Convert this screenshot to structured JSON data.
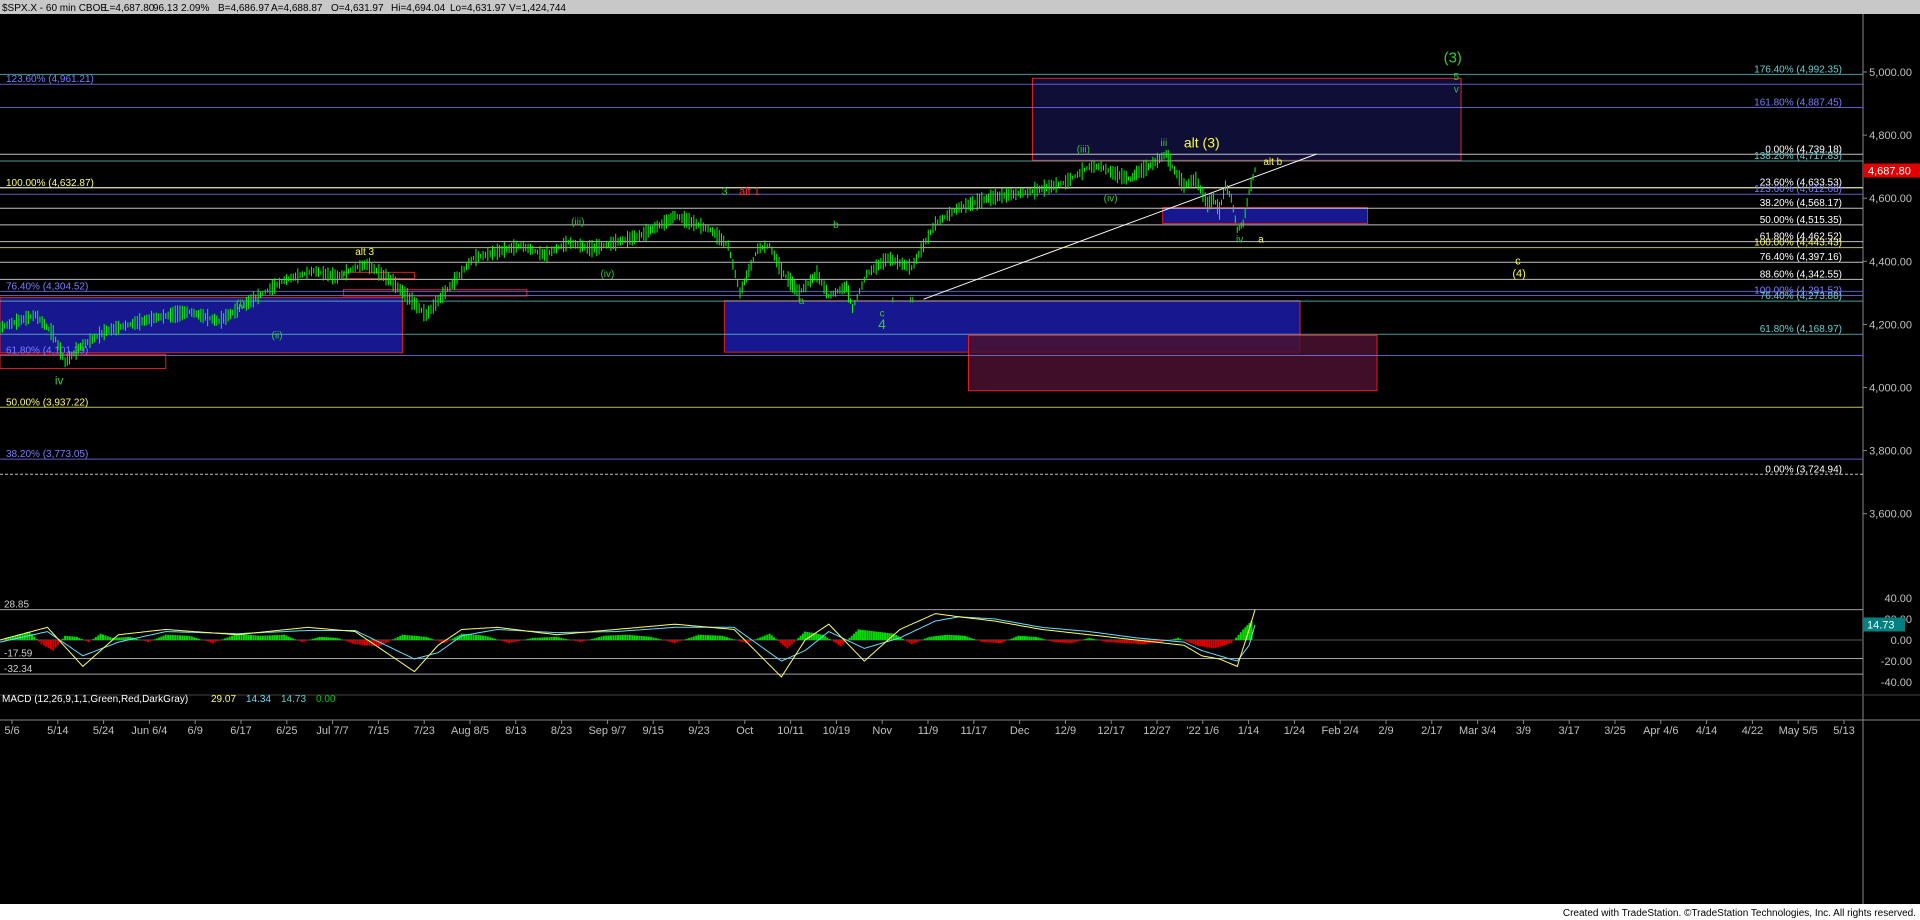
{
  "header": {
    "symbol": "$SPX.X - 60 min  CBOE",
    "last": "L=4,687.80",
    "change": "96.13",
    "pct": "2.09%",
    "bid": "B=4,686.97",
    "ask": "A=4,688.87",
    "open": "O=4,631.97",
    "high": "Hi=4,694.04",
    "low": "Lo=4,631.97",
    "volume": "V=1,424,744"
  },
  "footer": {
    "credit": "Created with TradeStation. ©TradeStation Technologies, Inc. All rights reserved."
  },
  "colors": {
    "background": "#000000",
    "price_bar": "#00ff00",
    "axis_text": "#c0c0c0",
    "fib_yellow": "#ffff66",
    "fib_blue": "#7b7bff",
    "fib_cyan": "#66cccc",
    "fib_white": "#ffffff",
    "box_blue": "#1a1a9e",
    "box_red_border": "#e02020",
    "box_purple": "#4a1030",
    "wave_green": "#33cc33",
    "wave_yellow": "#ffff33",
    "wave_red": "#ff3333",
    "macd_up": "#00dd00",
    "macd_down": "#dd0000"
  },
  "chart_data": [
    {
      "type": "line",
      "title": "$SPX.X - 60 min",
      "ylim": [
        3475,
        5075
      ],
      "y_ticks": [
        "5,000.00",
        "4,800.00",
        "4,600.00",
        "4,400.00",
        "4,200.00",
        "4,000.00",
        "3,800.00",
        "3,600.00"
      ],
      "y_tick_values": [
        5000,
        4800,
        4600,
        4400,
        4200,
        4000,
        3800,
        3600
      ],
      "last_price_label": "4,687.80",
      "last_price": 4687.8,
      "x_ticks": [
        "5/6",
        "5/14",
        "5/24",
        "Jun 6/4",
        "6/9",
        "6/17",
        "6/25",
        "Jul 7/7",
        "7/15",
        "7/23",
        "Aug 8/5",
        "8/13",
        "8/23",
        "Sep 9/7",
        "9/15",
        "9/23",
        "Oct",
        "10/11",
        "10/19",
        "Nov",
        "11/9",
        "11/17",
        "Dec",
        "12/9",
        "12/17",
        "12/27",
        "'22 1/6",
        "1/14",
        "1/24",
        "Feb 2/4",
        "2/9",
        "2/17",
        "Mar 3/4",
        "3/9",
        "3/17",
        "3/25",
        "Apr 4/6",
        "4/14",
        "4/22",
        "May 5/5",
        "5/13"
      ],
      "price_path": {
        "t": [
          0,
          30,
          45,
          55,
          68,
          90,
          130,
          160,
          185,
          210,
          240,
          265,
          285,
          300,
          310,
          330,
          360,
          400,
          440,
          460,
          480,
          500,
          540,
          555,
          565,
          570,
          580,
          600,
          615,
          625,
          640,
          650,
          660,
          675,
          690,
          700,
          715,
          720,
          732,
          750,
          770,
          790,
          810,
          835,
          850,
          870,
          900,
          920,
          930,
          940,
          955,
          960,
          970,
          985,
          990,
          1000,
          1010,
          1020,
          1025,
          1030,
          1035,
          1040,
          1045,
          1050,
          1055,
          1060
        ],
        "v": [
          4190,
          4230,
          4170,
          4080,
          4130,
          4180,
          4220,
          4240,
          4210,
          4270,
          4340,
          4370,
          4350,
          4380,
          4390,
          4340,
          4230,
          4410,
          4450,
          4420,
          4460,
          4440,
          4480,
          4510,
          4530,
          4545,
          4530,
          4500,
          4450,
          4300,
          4440,
          4450,
          4370,
          4300,
          4360,
          4290,
          4320,
          4250,
          4360,
          4410,
          4380,
          4520,
          4570,
          4600,
          4610,
          4620,
          4650,
          4700,
          4700,
          4680,
          4660,
          4680,
          4700,
          4740,
          4700,
          4640,
          4660,
          4580,
          4600,
          4560,
          4640,
          4600,
          4500,
          4520,
          4620,
          4690
        ]
      },
      "fib_lines": [
        {
          "label": "123.60% (4,961.21)",
          "value": 4961.21,
          "side": "left",
          "color": "#7b7bff"
        },
        {
          "label": "100.00% (4,632.87)",
          "value": 4632.87,
          "side": "left",
          "color": "#ffff66"
        },
        {
          "label": "76.40% (4,304.52)",
          "value": 4304.52,
          "side": "left",
          "color": "#7b7bff"
        },
        {
          "label": "61.80% (4,101.39)",
          "value": 4101.39,
          "side": "left",
          "color": "#7b7bff"
        },
        {
          "label": "50.00% (3,937.22)",
          "value": 3937.22,
          "side": "left",
          "color": "#ffff66"
        },
        {
          "label": "38.20% (3,773.05)",
          "value": 3773.05,
          "side": "left",
          "color": "#7b7bff"
        },
        {
          "label": "176.40% (4,992.35)",
          "value": 4992.35,
          "side": "right",
          "color": "#66cccc"
        },
        {
          "label": "161.80% (4,887.45)",
          "value": 4887.45,
          "side": "right",
          "color": "#7b7bff"
        },
        {
          "label": "0.00% (4,739.18)",
          "value": 4739.18,
          "side": "right",
          "color": "#ffffff"
        },
        {
          "label": "138.20% (4,717.83)",
          "value": 4717.83,
          "side": "right",
          "color": "#66cccc"
        },
        {
          "label": "23.60% (4,633.53)",
          "value": 4633.53,
          "side": "right",
          "color": "#ffffff"
        },
        {
          "label": "123.60% (4,612.68)",
          "value": 4612.68,
          "side": "right",
          "color": "#7b7bff"
        },
        {
          "label": "38.20% (4,568.17)",
          "value": 4568.17,
          "side": "right",
          "color": "#ffffff"
        },
        {
          "label": "50.00% (4,515.35)",
          "value": 4515.35,
          "side": "right",
          "color": "#ffffff"
        },
        {
          "label": "61.80% (4,462.52)",
          "value": 4462.52,
          "side": "right",
          "color": "#ffffff"
        },
        {
          "label": "100.00% (4,443.43)",
          "value": 4443.43,
          "side": "right",
          "color": "#ffff66"
        },
        {
          "label": "76.40% (4,397.16)",
          "value": 4397.16,
          "side": "right",
          "color": "#ffffff"
        },
        {
          "label": "88.60% (4,342.55)",
          "value": 4342.55,
          "side": "right",
          "color": "#ffffff"
        },
        {
          "label": "100.00% (4,291.52)",
          "value": 4291.52,
          "side": "right",
          "color": "#7b7bff"
        },
        {
          "label": "76.40% (4,273.88)",
          "value": 4273.88,
          "side": "right",
          "color": "#66cccc"
        },
        {
          "label": "61.80% (4,168.97)",
          "value": 4168.97,
          "side": "right",
          "color": "#66cccc"
        },
        {
          "label": "0.00% (3,724.94)",
          "value": 3724.94,
          "side": "right",
          "color": "#ffffff"
        }
      ],
      "zones": [
        {
          "kind": "blue",
          "t0": 0,
          "t1": 340,
          "v_top": 4285,
          "v_bottom": 4110
        },
        {
          "kind": "blue",
          "t0": 612,
          "t1": 1098,
          "v_top": 4275,
          "v_bottom": 4112
        },
        {
          "kind": "blue",
          "t0": 982,
          "t1": 1155,
          "v_top": 4570,
          "v_bottom": 4520
        },
        {
          "kind": "red-outline",
          "t0": 872,
          "t1": 1234,
          "v_top": 4980,
          "v_bottom": 4720
        },
        {
          "kind": "purple",
          "t0": 818,
          "t1": 1163,
          "v_top": 4165,
          "v_bottom": 3990
        },
        {
          "kind": "red-outline",
          "t0": 0,
          "t1": 140,
          "v_top": 4105,
          "v_bottom": 4060
        },
        {
          "kind": "red-outline",
          "t0": 290,
          "t1": 445,
          "v_top": 4310,
          "v_bottom": 4290
        },
        {
          "kind": "red-outline",
          "t0": 290,
          "t1": 350,
          "v_top": 4365,
          "v_bottom": 4345
        }
      ],
      "wave_labels": [
        {
          "text": "(3)",
          "t": 1227,
          "v": 5030,
          "color": "#33cc33",
          "size": 15
        },
        {
          "text": "5",
          "t": 1230,
          "v": 4975,
          "color": "#33cc33",
          "size": 10
        },
        {
          "text": "v",
          "t": 1230,
          "v": 4935,
          "color": "#33cc33",
          "size": 10
        },
        {
          "text": "(iii)",
          "t": 915,
          "v": 4745,
          "color": "#33cc33",
          "size": 10
        },
        {
          "text": "iii",
          "t": 983,
          "v": 4765,
          "color": "#33cc33",
          "size": 10
        },
        {
          "text": "alt (3)",
          "t": 1015,
          "v": 4760,
          "color": "#ffff33",
          "size": 14
        },
        {
          "text": "alt b",
          "t": 1075,
          "v": 4705,
          "color": "#ffff33",
          "size": 10
        },
        {
          "text": "(iv)",
          "t": 938,
          "v": 4590,
          "color": "#33cc33",
          "size": 10
        },
        {
          "text": "iv",
          "t": 1047,
          "v": 4460,
          "color": "#33cc33",
          "size": 10
        },
        {
          "text": "a",
          "t": 1065,
          "v": 4460,
          "color": "#ffff33",
          "size": 10
        },
        {
          "text": "3",
          "t": 612,
          "v": 4610,
          "color": "#33cc33",
          "size": 11
        },
        {
          "text": "alt 1",
          "t": 633,
          "v": 4610,
          "color": "#ff3333",
          "size": 11
        },
        {
          "text": "b",
          "t": 706,
          "v": 4505,
          "color": "#33cc33",
          "size": 10
        },
        {
          "text": "(iii)",
          "t": 488,
          "v": 4515,
          "color": "#33cc33",
          "size": 10
        },
        {
          "text": "(iv)",
          "t": 513,
          "v": 4350,
          "color": "#33cc33",
          "size": 10
        },
        {
          "text": "alt 3",
          "t": 308,
          "v": 4420,
          "color": "#ffff33",
          "size": 10
        },
        {
          "text": "(i)",
          "t": 203,
          "v": 4255,
          "color": "#33cc33",
          "size": 10
        },
        {
          "text": "(ii)",
          "t": 234,
          "v": 4155,
          "color": "#33cc33",
          "size": 10
        },
        {
          "text": "iv",
          "t": 50,
          "v": 4010,
          "color": "#33cc33",
          "size": 12
        },
        {
          "text": "a",
          "t": 677,
          "v": 4265,
          "color": "#33cc33",
          "size": 10
        },
        {
          "text": "c",
          "t": 745,
          "v": 4225,
          "color": "#33cc33",
          "size": 10
        },
        {
          "text": "4",
          "t": 745,
          "v": 4185,
          "color": "#33cc33",
          "size": 14
        },
        {
          "text": "i",
          "t": 754,
          "v": 4270,
          "color": "#33cc33",
          "size": 10
        },
        {
          "text": "ii",
          "t": 770,
          "v": 4270,
          "color": "#33cc33",
          "size": 10
        },
        {
          "text": "c",
          "t": 1282,
          "v": 4390,
          "color": "#ffff33",
          "size": 11
        },
        {
          "text": "(4)",
          "t": 1283,
          "v": 4350,
          "color": "#ffff33",
          "size": 11
        }
      ],
      "trendline": {
        "t0": 780,
        "v0": 4280,
        "t1": 1112,
        "v1": 4740
      }
    },
    {
      "type": "line",
      "title": "MACD (12,26,9,1,1,Green,Red,DarkGray)",
      "header_values": [
        "29.07",
        "14.34",
        "14.73",
        "0.00"
      ],
      "header_colors": [
        "#ffff66",
        "#66ddff",
        "#66cccc",
        "#00cc00"
      ],
      "ylim": [
        -48,
        48
      ],
      "y_ticks": [
        "40.00",
        "20.00",
        "0.00",
        "-20.00",
        "-40.00"
      ],
      "y_tick_values": [
        40,
        20,
        0,
        -20,
        -40
      ],
      "last_value_label": "14.73",
      "last_value": 14.73,
      "levels": [
        {
          "label": "28.85",
          "value": 28.85
        },
        {
          "label": "-17.59",
          "value": -17.59
        },
        {
          "label": "-32.34",
          "value": -32.34
        }
      ],
      "macd_line": {
        "t": [
          0,
          40,
          70,
          100,
          140,
          200,
          260,
          300,
          350,
          370,
          390,
          420,
          470,
          520,
          570,
          620,
          660,
          680,
          700,
          730,
          760,
          790,
          810,
          840,
          880,
          920,
          960,
          1000,
          1015,
          1030,
          1045,
          1055,
          1060
        ],
        "v": [
          0,
          12,
          -25,
          5,
          10,
          5,
          12,
          8,
          -30,
          -5,
          10,
          12,
          5,
          10,
          15,
          10,
          -35,
          0,
          15,
          -20,
          10,
          25,
          22,
          18,
          10,
          5,
          0,
          -5,
          -15,
          -18,
          -25,
          10,
          28.85
        ]
      },
      "signal_line": {
        "t": [
          0,
          40,
          70,
          100,
          140,
          200,
          260,
          300,
          350,
          370,
          390,
          420,
          470,
          520,
          570,
          620,
          660,
          680,
          700,
          730,
          760,
          790,
          810,
          840,
          880,
          920,
          960,
          1000,
          1015,
          1030,
          1045,
          1055,
          1060
        ],
        "v": [
          -2,
          8,
          -15,
          -2,
          8,
          6,
          9,
          9,
          -18,
          -12,
          4,
          10,
          7,
          8,
          12,
          12,
          -20,
          -10,
          8,
          -8,
          2,
          18,
          22,
          20,
          12,
          8,
          2,
          -2,
          -10,
          -15,
          -20,
          -5,
          14.34
        ]
      },
      "histogram": {
        "t": [
          5,
          15,
          25,
          35,
          45,
          55,
          65,
          75,
          85,
          95,
          110,
          125,
          140,
          160,
          180,
          200,
          220,
          240,
          255,
          270,
          285,
          300,
          320,
          340,
          360,
          375,
          390,
          410,
          430,
          450,
          470,
          490,
          510,
          530,
          550,
          570,
          590,
          610,
          630,
          650,
          665,
          680,
          695,
          710,
          725,
          740,
          755,
          770,
          785,
          800,
          815,
          830,
          845,
          860,
          875,
          890,
          905,
          920,
          935,
          950,
          965,
          980,
          995,
          1010,
          1025,
          1040,
          1050,
          1057
        ],
        "v": [
          2,
          5,
          8,
          -4,
          -10,
          4,
          3,
          -2,
          6,
          2,
          3,
          -2,
          5,
          4,
          -3,
          6,
          4,
          5,
          -2,
          3,
          2,
          -4,
          -6,
          5,
          3,
          -3,
          6,
          4,
          -3,
          2,
          3,
          -2,
          4,
          5,
          3,
          -3,
          5,
          4,
          -3,
          6,
          -8,
          8,
          5,
          -6,
          10,
          8,
          6,
          -4,
          3,
          5,
          4,
          -2,
          -3,
          4,
          3,
          -2,
          -3,
          2,
          -2,
          -3,
          -4,
          -2,
          2,
          -5,
          -8,
          -3,
          10,
          18
        ]
      }
    }
  ]
}
